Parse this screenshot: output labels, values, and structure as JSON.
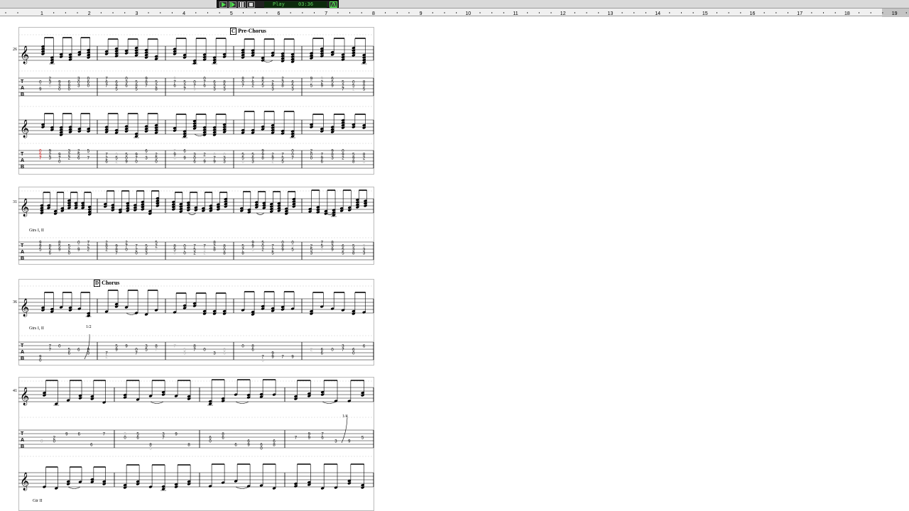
{
  "transport": {
    "status_text": "Play",
    "time_text": "03:36",
    "buttons": [
      "play-icon",
      "play-from-start-icon",
      "pause-icon",
      "stop-icon",
      "metronome-icon"
    ]
  },
  "ruler": {
    "bar_numbers": [
      "1",
      "2",
      "3",
      "4",
      "5",
      "6",
      "7",
      "8",
      "9",
      "10",
      "11",
      "12",
      "13",
      "14",
      "15",
      "16",
      "17",
      "18",
      "19"
    ],
    "selected_bar": "19"
  },
  "score": {
    "sections": [
      {
        "letter": "C",
        "name": "Pre-Chorus"
      },
      {
        "letter": "D",
        "name": "Chorus"
      }
    ],
    "measure_numbers": [
      "26",
      "31",
      "36",
      "41"
    ],
    "guitar_labels": [
      "Gtrs I, II",
      "Gtrs I, II",
      "Gtr II"
    ],
    "bend_labels": [
      "1/2",
      "1/4"
    ],
    "tab_letters": [
      "T",
      "A",
      "B"
    ]
  },
  "colors": {
    "accent_red": "#d40000",
    "lcd_text": "#5fd35f",
    "ruler_bg": "#f0f0f0",
    "transport_bg": "#222222"
  }
}
